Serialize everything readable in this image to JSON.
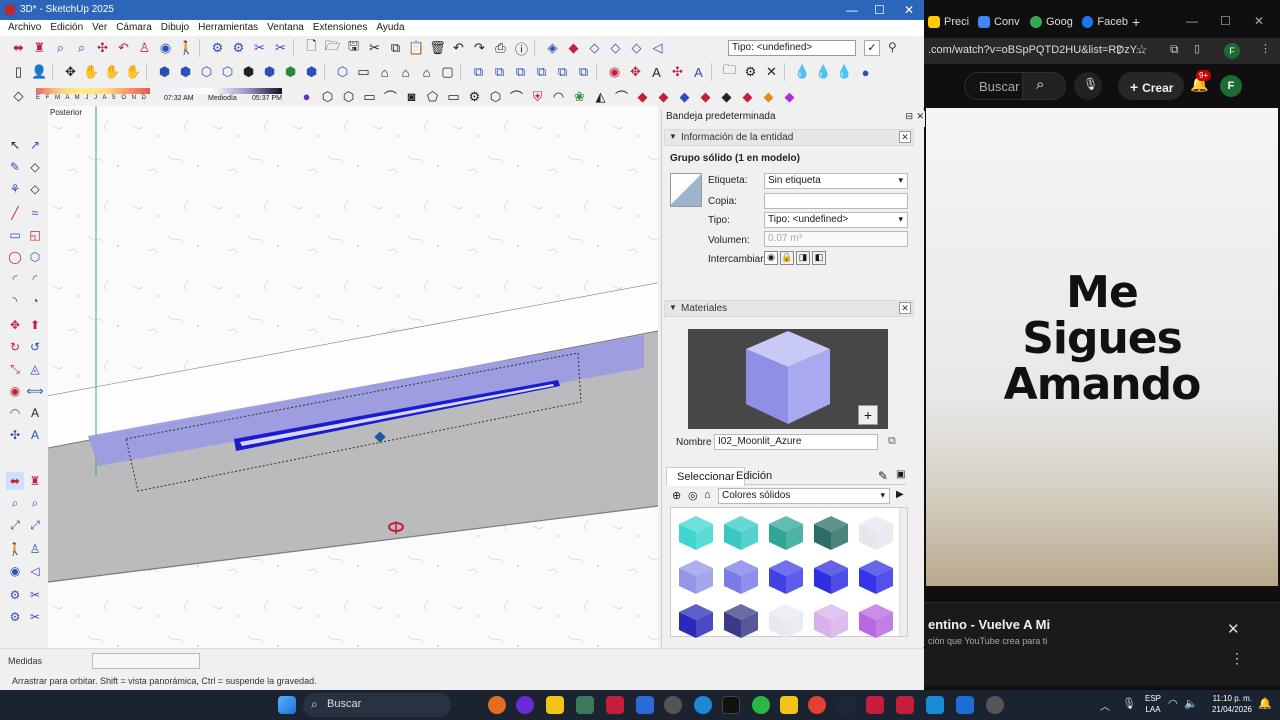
{
  "sketchup": {
    "title": "3D* - SketchUp 2025",
    "menu": [
      "Archivo",
      "Edición",
      "Ver",
      "Cámara",
      "Dibujo",
      "Herramientas",
      "Ventana",
      "Extensiones",
      "Ayuda"
    ],
    "type_box": "Tipo: <undefined>",
    "shadow_months": "E F M A M J J A S O N D",
    "shadow_time_start": "07:32 AM",
    "shadow_mid": "Mediodía",
    "shadow_time_end": "05:37 PM",
    "viewport_label": "Posterior",
    "status_measure_label": "Medidas",
    "status_hint": "Arrastrar para orbitar. Shift = vista panorámica, Ctrl = suspende la gravedad."
  },
  "tray": {
    "title": "Bandeja predeterminada",
    "entity_panel": {
      "header": "Información de la entidad",
      "entity_title": "Grupo sólido (1 en modelo)",
      "tag_label": "Etiqueta:",
      "tag_value": "Sin etiqueta",
      "copy_label": "Copia:",
      "copy_value": "",
      "type_label": "Tipo:",
      "type_value": "Tipo: <undefined>",
      "volume_label": "Volumen:",
      "volume_value": "0.07 m³",
      "swap_label": "Intercambiar:"
    },
    "materials_panel": {
      "header": "Materiales",
      "name_label": "Nombre",
      "name_value": "I02_Moonlit_Azure",
      "tab_select": "Seleccionar",
      "tab_edit": "Edición",
      "library": "Colores sólidos",
      "swatches": [
        "#3fd6d0",
        "#36c9c4",
        "#2fa597",
        "#2c6e66",
        "#e6e6ee",
        "#9595e8",
        "#7b7be8",
        "#4141e6",
        "#2f2fe0",
        "#3434e8",
        "#2a2ab8",
        "#3a3a88",
        "#e8e8f0",
        "#d8b0ea",
        "#b868e0"
      ]
    }
  },
  "chrome": {
    "tabs": [
      "Preci",
      "Conv",
      "Goog",
      "Faceb"
    ],
    "tab_add": "+",
    "url": ".com/watch?v=oBSpPQTD2HU&list=RDzY...",
    "profile_letter": "F",
    "youtube": {
      "search_placeholder": "Buscar",
      "create_label": "Crear",
      "notif_badge": "9+",
      "avatar_letter": "F",
      "video_title_lines": [
        "Me",
        "Sigues",
        "Amando"
      ],
      "mix_title": "entino - Vuelve A Mi",
      "mix_sub": "ción que YouTube crea para ti"
    }
  },
  "taskbar": {
    "search_label": "Buscar",
    "lang_top": "ESP",
    "lang_bottom": "LAA",
    "time": "11:10 p. m.",
    "date": "21/04/2026"
  }
}
